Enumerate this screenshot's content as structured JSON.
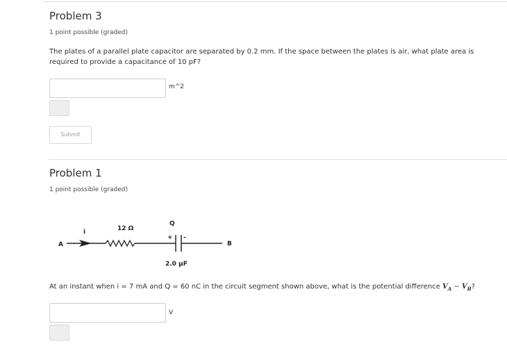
{
  "problem3": {
    "title": "Problem 3",
    "meta": "1 point possible (graded)",
    "question_line1": "The plates of a parallel plate capacitor are separated by 0.2 mm. If the space between the plates is air, what plate area is",
    "question_line2": "required to provide a capacitance of 10 pF?",
    "answer_value": "",
    "unit": "m^2",
    "submit_label": "Submit"
  },
  "problem1": {
    "title": "Problem 1",
    "meta": "1 point possible (graded)",
    "question": "At an instant when i = 7 mA and Q = 60 nC in the circuit segment shown above, what is the potential difference ",
    "question_expr_a": "V",
    "question_sub_a": "A",
    "question_minus": " − ",
    "question_expr_b": "V",
    "question_sub_b": "B",
    "question_end": "?",
    "answer_value": "",
    "unit": "V",
    "circuit": {
      "node_a": "A",
      "node_b": "B",
      "current": "i",
      "resistor": "12 Ω",
      "charge": "Q",
      "plus": "+",
      "minus": "-",
      "capacitor": "2.0 μF"
    }
  }
}
